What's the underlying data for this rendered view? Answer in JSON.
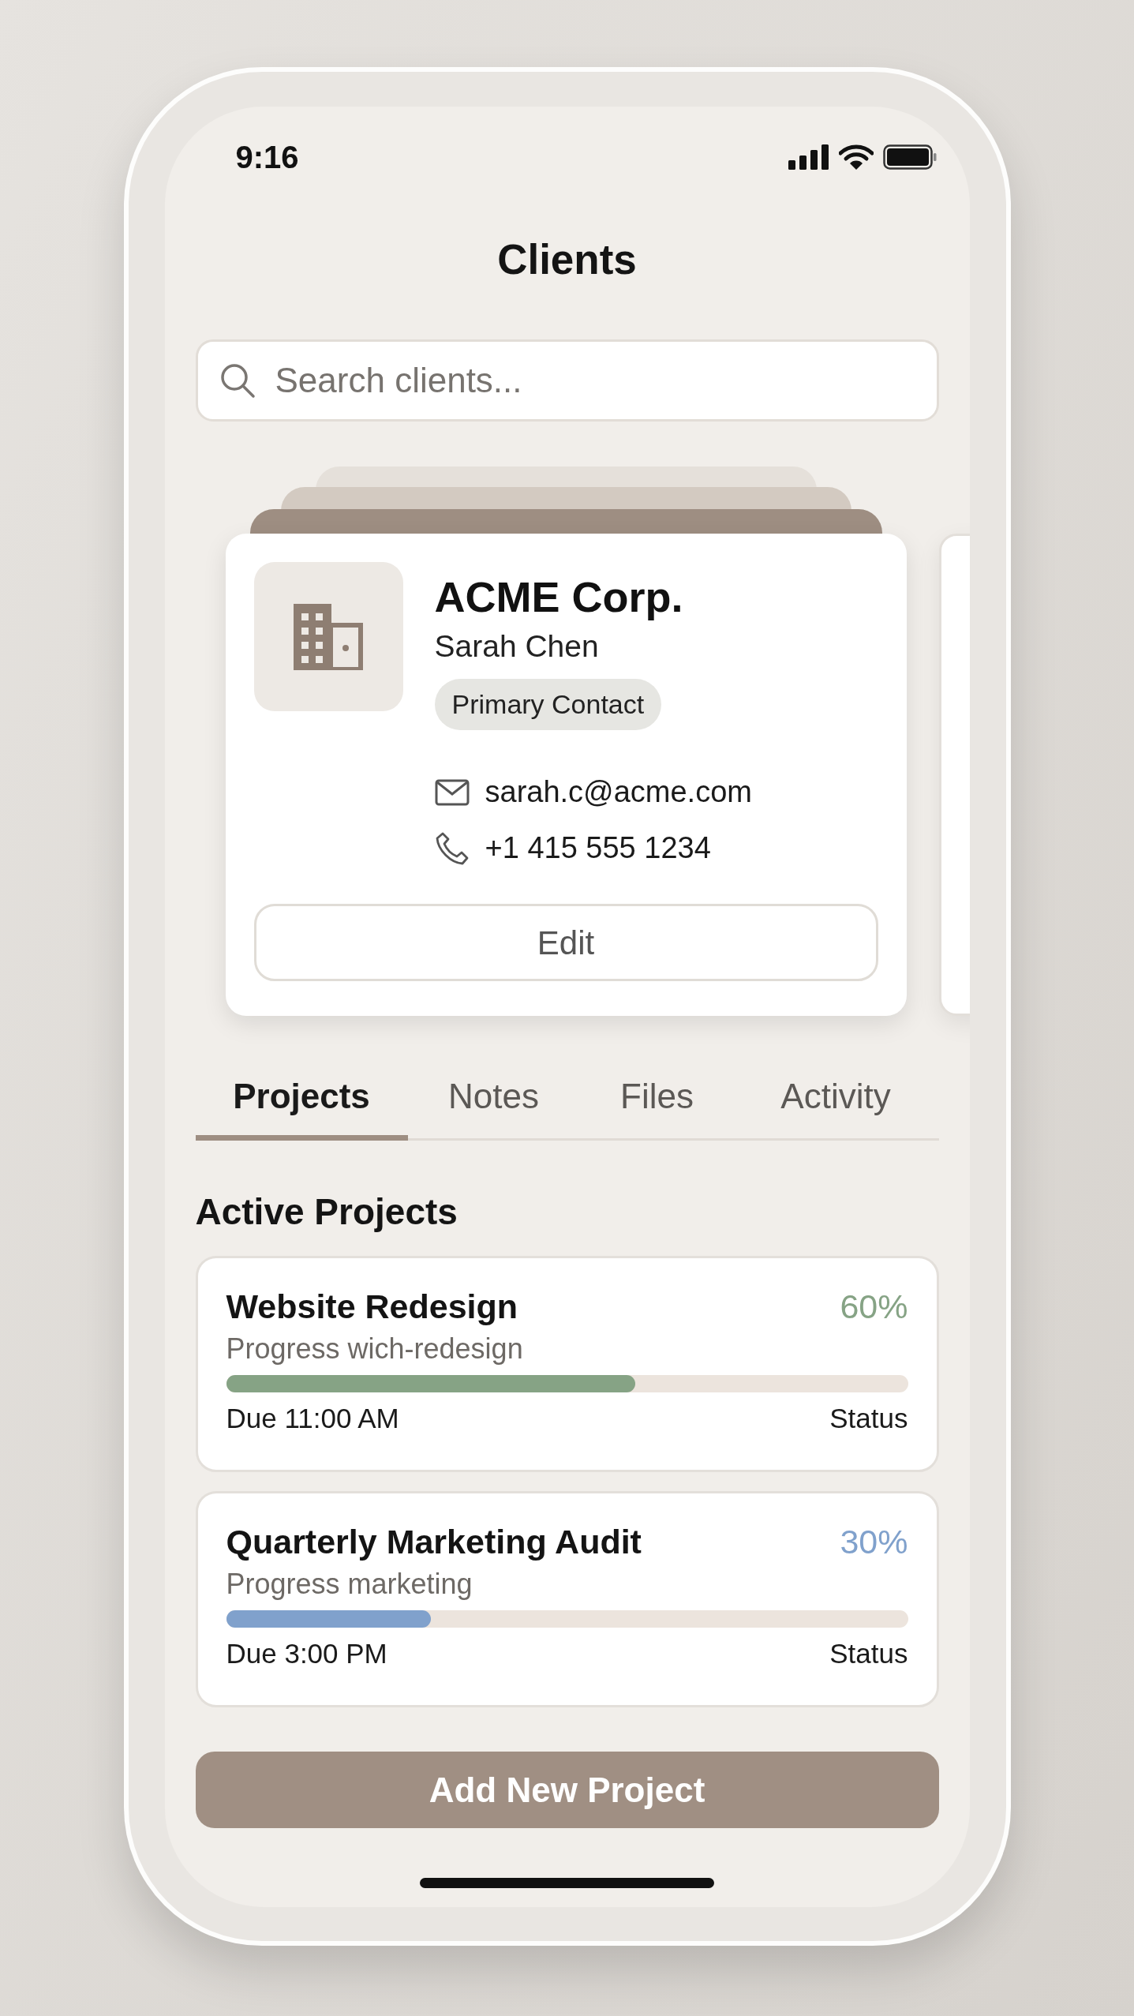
{
  "status_bar": {
    "time": "9:16"
  },
  "header": {
    "title": "Clients"
  },
  "search": {
    "placeholder": "Search clients..."
  },
  "client_card": {
    "company": "ACME Corp.",
    "contact_name": "Sarah Chen",
    "badge": "Primary Contact",
    "email": "sarah.c@acme.com",
    "phone": "+1 415 555 1234",
    "edit_button": "Edit"
  },
  "tabs": [
    {
      "label": "Projects",
      "selected": true
    },
    {
      "label": "Notes",
      "selected": false
    },
    {
      "label": "Files",
      "selected": false
    },
    {
      "label": "Activity",
      "selected": false
    }
  ],
  "section_title": "Active Projects",
  "projects": [
    {
      "name": "Website Redesign",
      "percent": "60%",
      "subtitle": "Progress wich-redesign",
      "level": 0.6,
      "color": "#86a385",
      "due": "Due 11:00 AM",
      "status": "Status"
    },
    {
      "name": "Quarterly Marketing Audit",
      "percent": "30%",
      "subtitle": "Progress marketing",
      "level": 0.3,
      "color": "#80a1cc",
      "due": "Due 3:00 PM",
      "status": "Status"
    }
  ],
  "primary_button": "Add New Project"
}
